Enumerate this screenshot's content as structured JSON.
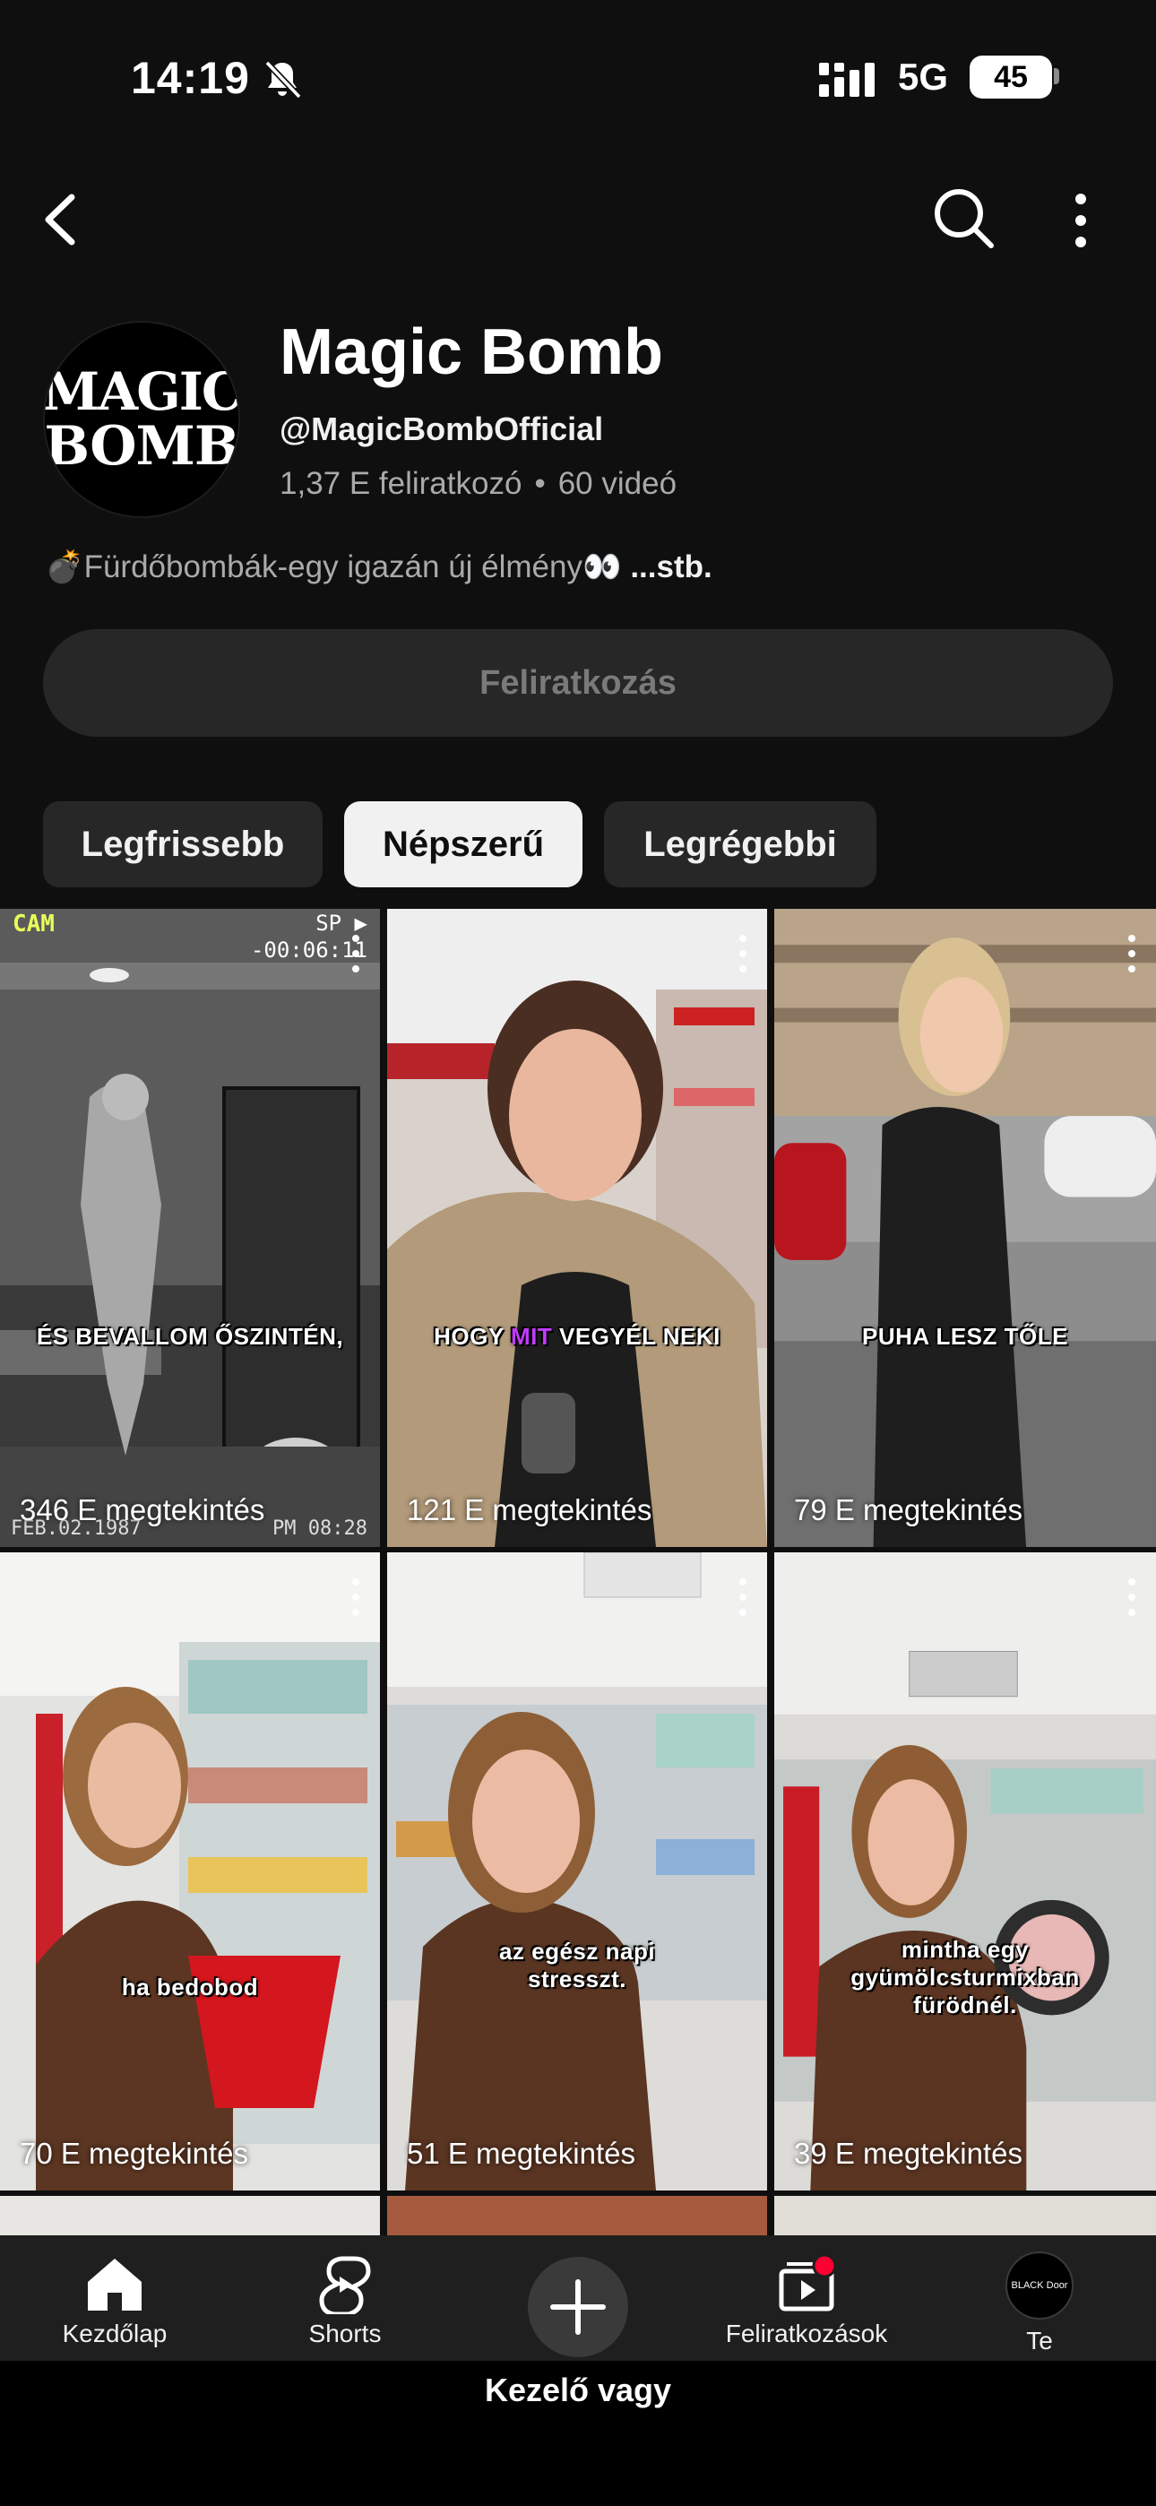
{
  "status": {
    "time": "14:19",
    "network": "5G",
    "battery": "45"
  },
  "channel": {
    "logo_line1": "MAGIC",
    "logo_line2": "BOMB",
    "name": "Magic Bomb",
    "handle": "@MagicBombOfficial",
    "subscribers": "1,37 E feliratkozó",
    "videos": "60 videó",
    "description": "💣Fürdőbombák-egy igazán új élmény👀",
    "description_more": "...stb.",
    "subscribe_label": "Feliratkozás"
  },
  "chips": [
    "Legfrissebb",
    "Népszerű",
    "Legrégebbi"
  ],
  "active_chip": "Népszerű",
  "videos": [
    {
      "views": "346 E megtekintés",
      "caption": "ÉS BEVALLOM ŐSZINTÉN,",
      "cam_label": "CAM",
      "cam_mode": "SP ▶",
      "cam_time": "-00:06:11",
      "cam_date": "FEB.02.1987",
      "cam_clock": "PM 08:28"
    },
    {
      "views": "121 E megtekintés",
      "caption_a": "HOGY ",
      "caption_hl": "MIT",
      "caption_b": " VEGYÉL  NEKI"
    },
    {
      "views": "79 E megtekintés",
      "caption": "PUHA LESZ TŐLE"
    },
    {
      "views": "70 E megtekintés",
      "caption": "ha bedobod"
    },
    {
      "views": "51 E megtekintés",
      "caption": "az egész napi stresszt."
    },
    {
      "views": "39 E megtekintés",
      "caption": "mintha egy gyümölcsturmixban fürödnél."
    }
  ],
  "nav": {
    "home": "Kezdőlap",
    "shorts": "Shorts",
    "subscriptions": "Feliratkozások",
    "you": "Te",
    "you_avatar_text": "BLACK Door"
  },
  "footer": "Kezelő vagy"
}
